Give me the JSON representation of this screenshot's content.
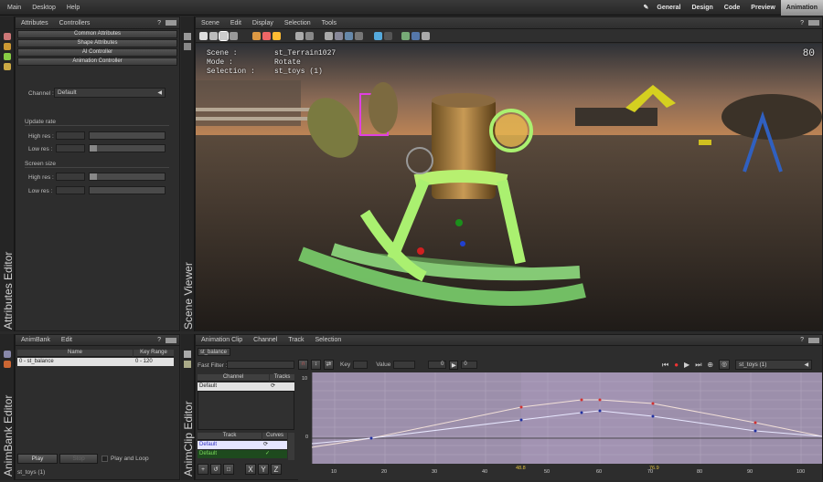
{
  "topbar": {
    "menus": [
      "Main",
      "Desktop",
      "Help"
    ],
    "workspaces": [
      "General",
      "Design",
      "Code",
      "Preview",
      "Animation"
    ],
    "active_workspace": "Animation"
  },
  "attr_panel": {
    "tabs": [
      "Attributes",
      "Controllers"
    ],
    "help": "?",
    "sections": [
      "Common Attributes",
      "Shape Attributes",
      "AI Controller",
      "Animation Controller"
    ],
    "channel_label": "Channel :",
    "channel_value": "Default",
    "update_rate": "Update rate",
    "screen_size": "Screen size",
    "high_res": "High res :",
    "low_res": "Low res :",
    "vertical_title": "Attributes Editor"
  },
  "scene": {
    "menus": [
      "Scene",
      "Edit",
      "Display",
      "Selection",
      "Tools"
    ],
    "help": "?",
    "vertical_title": "Scene Viewer",
    "scene_label": "Scene :",
    "scene_value": "st_Terrain1027",
    "mode_label": "Mode :",
    "mode_value": "Rotate",
    "selection_label": "Selection :",
    "selection_value": "st_toys (1)",
    "fps": "80"
  },
  "animbank": {
    "menus": [
      "AnimBank",
      "Edit"
    ],
    "help": "?",
    "col_name": "Name",
    "col_range": "Key Range",
    "row_name": "0 - st_balance",
    "row_range": "0 - 120",
    "play": "Play",
    "stop": "Stop",
    "play_loop": "Play and Loop",
    "status": "st_toys (1)",
    "vertical_title": "AnimBank Editor"
  },
  "animclip": {
    "menus": [
      "Animation Clip",
      "Channel",
      "Track",
      "Selection"
    ],
    "help": "?",
    "tab": "st_balance",
    "vertical_title": "AnimClip Editor",
    "fast_filter": "Fast Filter :",
    "key_label": "Key",
    "value_label": "Value",
    "frame_a": "0",
    "frame_b": "0",
    "target": "st_toys (1)",
    "channel_col": "Channel",
    "tracks_col": "Tracks",
    "channel_row": "Default",
    "track_col": "Track",
    "curves_col": "Curves",
    "track_rows": [
      "Default",
      "Default"
    ],
    "axis_x": [
      "10",
      "20",
      "30",
      "40",
      "48.8",
      "50",
      "60",
      "70",
      "76.9",
      "80",
      "90",
      "100"
    ],
    "axis_y_top": "10",
    "axis_y_mid": "0",
    "xyz": [
      "X",
      "Y",
      "Z"
    ]
  }
}
